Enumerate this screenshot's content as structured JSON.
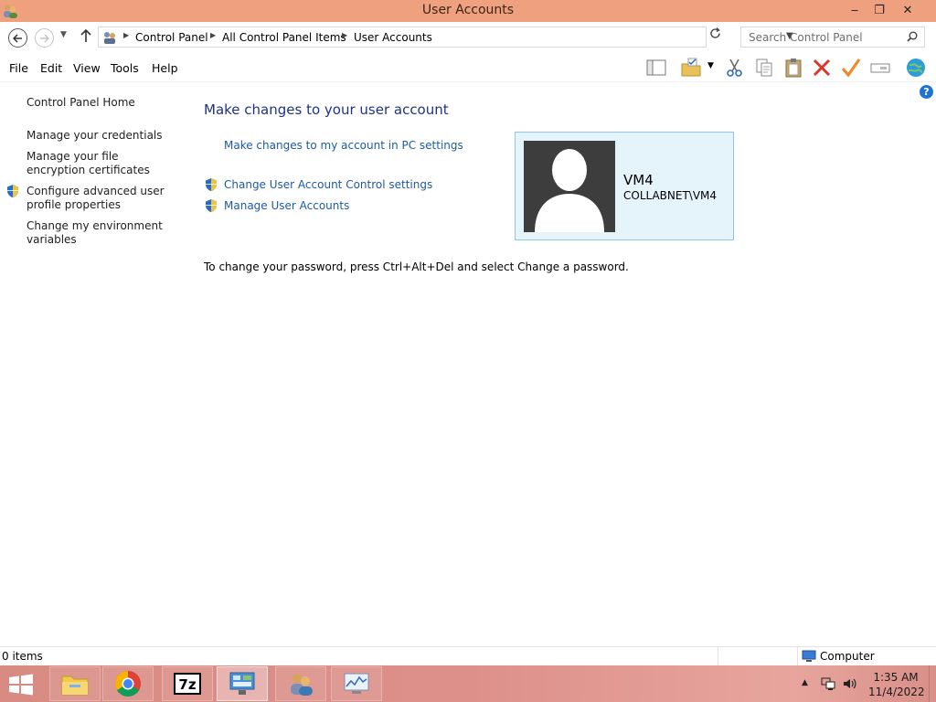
{
  "window": {
    "title": "User Accounts",
    "minimize": "‒",
    "maximize": "❐",
    "close": "✕"
  },
  "address": {
    "breadcrumbs": [
      "Control Panel",
      "All Control Panel Items",
      "User Accounts"
    ],
    "search_placeholder": "Search Control Panel"
  },
  "menu": [
    "File",
    "Edit",
    "View",
    "Tools",
    "Help"
  ],
  "toolbar_icons": [
    "layout-icon",
    "folder-check-icon",
    "cut-icon",
    "copy-icon",
    "paste-icon",
    "delete-icon",
    "checkmark-icon",
    "rename-icon",
    "globe-icon"
  ],
  "left_nav": {
    "home": "Control Panel Home",
    "items": [
      "Manage your credentials",
      "Manage your file encryption certificates",
      "Configure advanced user profile properties",
      "Change my environment variables"
    ]
  },
  "main": {
    "title": "Make changes to your user account",
    "pc_settings_link": "Make changes to my account in PC settings",
    "uac_link": "Change User Account Control settings",
    "manage_link": "Manage User Accounts",
    "password_note": "To change your password, press Ctrl+Alt+Del and select Change a password."
  },
  "user": {
    "name": "VM4",
    "domain": "COLLABNET\\VM4"
  },
  "status": {
    "items": "0 items",
    "location": "Computer"
  },
  "taskbar": {
    "apps": [
      "file-explorer-icon",
      "chrome-icon",
      "7zip-icon",
      "control-panel-icon",
      "user-accounts-icon",
      "performance-monitor-icon"
    ],
    "time": "1:35 AM",
    "date": "11/4/2022"
  },
  "colors": {
    "titlebar": "#efa17f",
    "link": "#1e5aa0",
    "heading": "#1e3287",
    "user_card_bg": "#e5f3fb",
    "user_card_border": "#8fc6e4"
  }
}
